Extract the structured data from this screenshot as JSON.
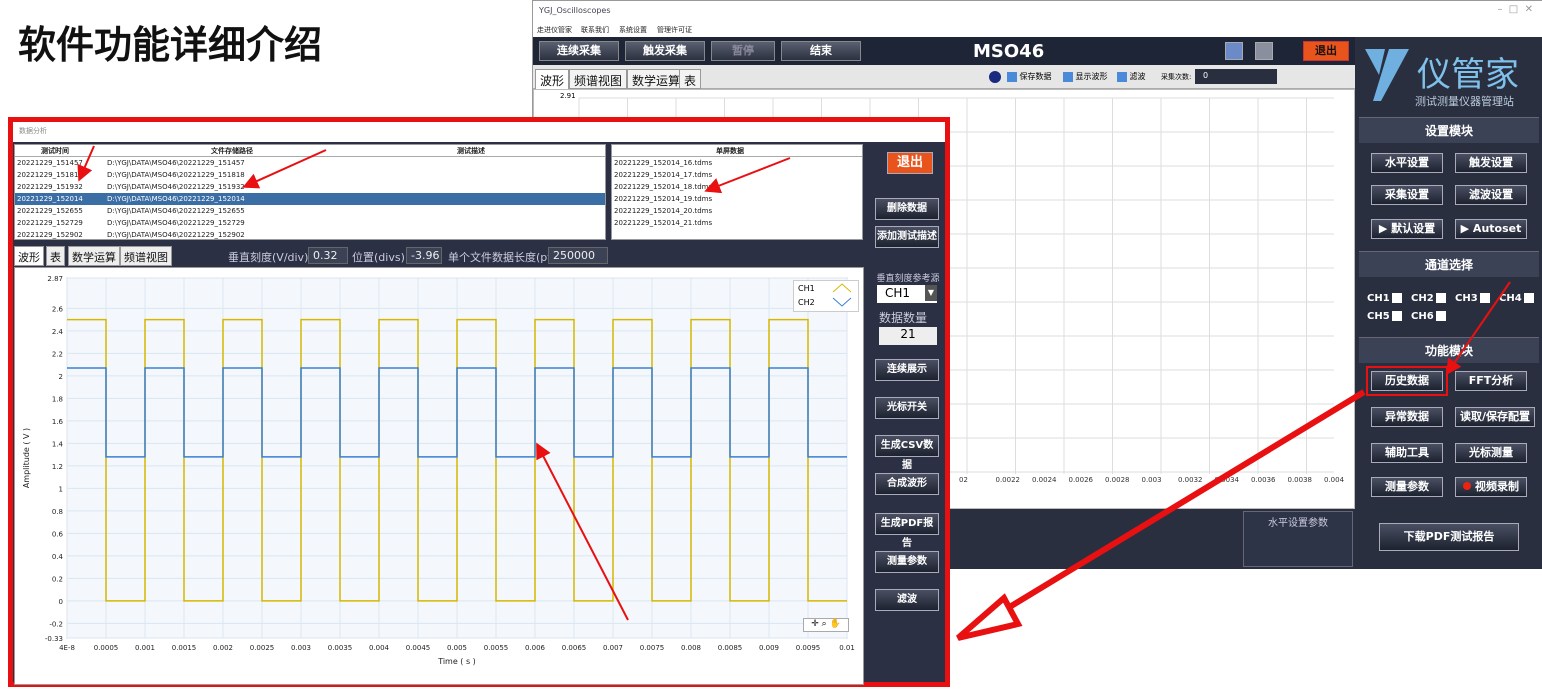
{
  "page_title": "软件功能详细介绍",
  "back_window": {
    "title": "YGJ_Oscilloscopes",
    "menu": [
      "走进仪管家",
      "联系我们",
      "系统设置",
      "管理许可证"
    ],
    "toolbar": {
      "continuous": "连续采集",
      "trigger": "触发采集",
      "pause": "暂停",
      "stop": "结束",
      "model": "MSO46",
      "exit": "退出"
    },
    "tabs": [
      "波形",
      "频谱视图",
      "数学运算",
      "表"
    ],
    "options": {
      "save": "保存数据",
      "show": "显示波形",
      "filter": "滤波",
      "count_label": "采集次数:",
      "count_value": "0"
    },
    "y_top": "2.91",
    "x_ticks": [
      "02",
      "0.0022",
      "0.0024",
      "0.0026",
      "0.0028",
      "0.003",
      "0.0032",
      "0.0034",
      "0.0036",
      "0.0038",
      "0.004"
    ],
    "hparam_title": "水平设置参数",
    "logo": {
      "brand": "仪管家",
      "sub": "测试测量仪器管理站"
    },
    "settings": {
      "title": "设置模块",
      "h": "水平设置",
      "trig": "触发设置",
      "acq": "采集设置",
      "filt": "滤波设置",
      "def": "▶ 默认设置",
      "auto": "▶ Autoset"
    },
    "channels": {
      "title": "通道选择",
      "items": [
        "CH1",
        "CH2",
        "CH3",
        "CH4",
        "CH5",
        "CH6"
      ]
    },
    "functions": {
      "title": "功能模块",
      "hist": "历史数据",
      "fft": "FFT分析",
      "abn": "异常数据",
      "rw": "读取/保存配置",
      "aux": "辅助工具",
      "cursor": "光标测量",
      "meas": "测量参数",
      "rec": "视频录制"
    },
    "pdf": "下载PDF测试报告"
  },
  "front_window": {
    "title": "数据分析",
    "exit": "退出",
    "table_headers": [
      "测试时间",
      "文件存储路径",
      "测试描述"
    ],
    "rows": [
      [
        "20221229_151457",
        "D:\\YGJ\\DATA\\MSO46\\20221229_151457"
      ],
      [
        "20221229_151818",
        "D:\\YGJ\\DATA\\MSO46\\20221229_151818"
      ],
      [
        "20221229_151932",
        "D:\\YGJ\\DATA\\MSO46\\20221229_151932"
      ],
      [
        "20221229_152014",
        "D:\\YGJ\\DATA\\MSO46\\20221229_152014"
      ],
      [
        "20221229_152655",
        "D:\\YGJ\\DATA\\MSO46\\20221229_152655"
      ],
      [
        "20221229_152729",
        "D:\\YGJ\\DATA\\MSO46\\20221229_152729"
      ],
      [
        "20221229_152902",
        "D:\\YGJ\\DATA\\MSO46\\20221229_152902"
      ]
    ],
    "selected_row": 3,
    "single_header": "单屏数据",
    "single_files": [
      "20221229_152014_16.tdms",
      "20221229_152014_17.tdms",
      "20221229_152014_18.tdms",
      "20221229_152014_19.tdms",
      "20221229_152014_20.tdms",
      "20221229_152014_21.tdms"
    ],
    "delete": "删除数据",
    "add_desc": "添加测试描述",
    "tabs": [
      "波形",
      "表",
      "数学运算",
      "频谱视图"
    ],
    "vdiv_label": "垂直刻度(V/div):",
    "vdiv_value": "0.32",
    "pos_label": "位置(divs):",
    "pos_value": "-3.96",
    "len_label": "单个文件数据长度(pts):",
    "len_value": "250000",
    "ref_label": "垂直刻度参考源",
    "ref_value": "CH1",
    "count_label": "数据数量",
    "count_value": "21",
    "side_buttons": [
      "连续展示",
      "光标开关",
      "生成CSV数据",
      "合成波形",
      "生成PDF报告",
      "测量参数",
      "滤波"
    ]
  },
  "chart_data": {
    "type": "line",
    "ylabel": "Amplitude ( V )",
    "xlabel": "Time ( s )",
    "ylim": [
      -0.33,
      2.87
    ],
    "xlim": [
      4e-08,
      0.01
    ],
    "y_ticks": [
      "2.87",
      "2.6",
      "2.4",
      "2.2",
      "2",
      "1.8",
      "1.6",
      "1.4",
      "1.2",
      "1",
      "0.8",
      "0.6",
      "0.4",
      "0.2",
      "0",
      "-0.2",
      "-0.33"
    ],
    "y_tick_values": [
      2.87,
      2.6,
      2.4,
      2.2,
      2,
      1.8,
      1.6,
      1.4,
      1.2,
      1,
      0.8,
      0.6,
      0.4,
      0.2,
      0,
      -0.2,
      -0.33
    ],
    "x_ticks": [
      "4E-8",
      "0.0005",
      "0.001",
      "0.0015",
      "0.002",
      "0.0025",
      "0.003",
      "0.0035",
      "0.004",
      "0.0045",
      "0.005",
      "0.0055",
      "0.006",
      "0.0065",
      "0.007",
      "0.0075",
      "0.008",
      "0.0085",
      "0.009",
      "0.0095",
      "0.01"
    ],
    "x_tick_values": [
      0,
      0.0005,
      0.001,
      0.0015,
      0.002,
      0.0025,
      0.003,
      0.0035,
      0.004,
      0.0045,
      0.005,
      0.0055,
      0.006,
      0.0065,
      0.007,
      0.0075,
      0.008,
      0.0085,
      0.009,
      0.0095,
      0.01
    ],
    "period": 0.001,
    "series": [
      {
        "name": "CH1",
        "color": "#d4b800",
        "high": 2.5,
        "low": 0.0,
        "high_first": true
      },
      {
        "name": "CH2",
        "color": "#3a7fd4",
        "high": 2.07,
        "low": 1.28,
        "high_first": true
      }
    ],
    "grid": true,
    "legend": "top-right"
  }
}
